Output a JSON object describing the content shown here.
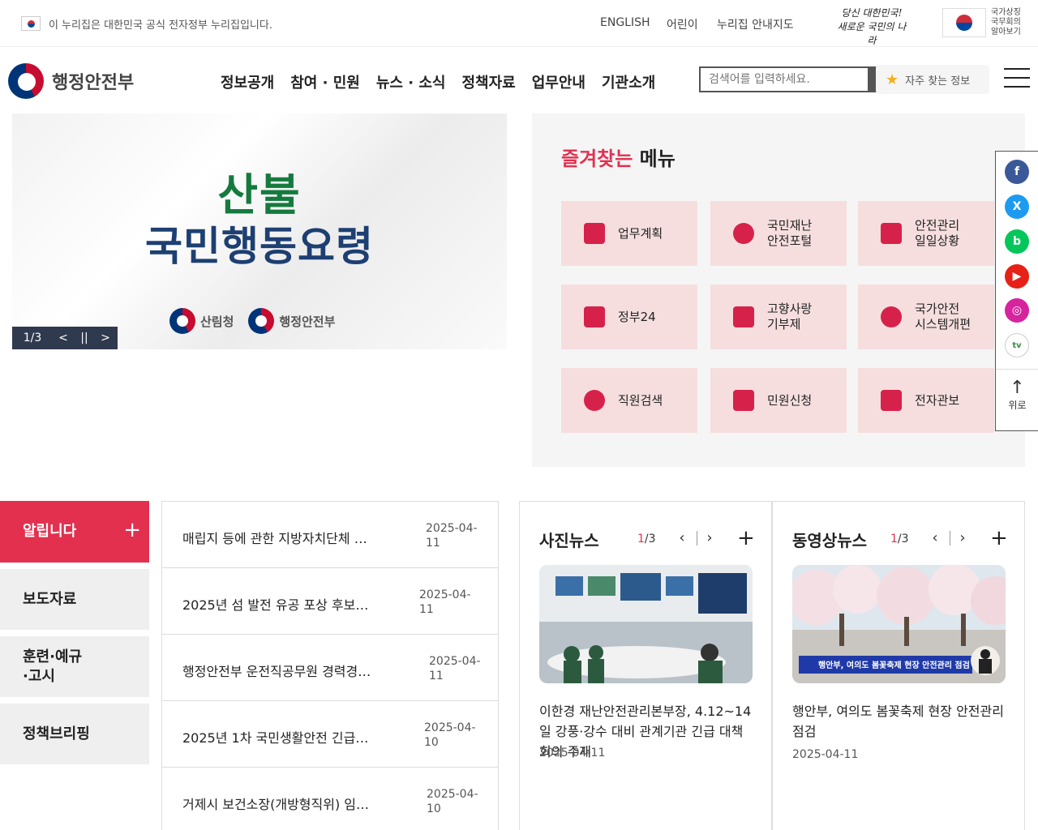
{
  "gov_banner": {
    "text": "이 누리집은 대한민국 공식 전자정부 누리집입니다.",
    "links": [
      "ENGLISH",
      "어린이",
      "누리집 안내지도"
    ],
    "slogan_line1": "당신 대한민국!",
    "slogan_line2": "새로운 국민의 나라",
    "council_lines": [
      "국가상징",
      "국무회의",
      "알아보기"
    ]
  },
  "header": {
    "logo_text": "행정안전부",
    "nav": [
      "정보공개",
      "참여 · 민원",
      "뉴스 · 소식",
      "정책자료",
      "업무안내",
      "기관소개"
    ],
    "search_placeholder": "검색어를 입력하세요.",
    "fav_label": "자주 찾는 정보"
  },
  "hero": {
    "title_line1": "산불",
    "title_line2": "국민행동요령",
    "org1": "산림청",
    "org2": "행정안전부",
    "counter": "1/3",
    "prev": "<",
    "pause": "||",
    "next": ">"
  },
  "favorites": {
    "title_pink": "즐겨찾는",
    "title_rest": " 메뉴",
    "tiles": [
      {
        "line1": "업무계획",
        "line2": ""
      },
      {
        "line1": "국민재난",
        "line2": "안전포털"
      },
      {
        "line1": "안전관리",
        "line2": "일일상황"
      },
      {
        "line1": "정부24",
        "line2": ""
      },
      {
        "line1": "고향사랑",
        "line2": "기부제"
      },
      {
        "line1": "국가안전",
        "line2": "시스템개편"
      },
      {
        "line1": "직원검색",
        "line2": ""
      },
      {
        "line1": "민원신청",
        "line2": ""
      },
      {
        "line1": "전자관보",
        "line2": ""
      }
    ]
  },
  "social": {
    "top_label": "위로",
    "colors": {
      "facebook": "#3b5998",
      "x": "#1d9bf0",
      "blog": "#03c75a",
      "youtube": "#e62117",
      "instagram": "#d6249f",
      "tv": "#3b8c3b"
    }
  },
  "notice": {
    "tabs": [
      {
        "label": "알립니다",
        "plus": "+"
      },
      {
        "label": "보도자료"
      },
      {
        "label_line1": "훈련·예규",
        "label_line2": "·고시"
      },
      {
        "label": "정책브리핑"
      }
    ],
    "items": [
      {
        "title": "매립지 등에 관한 지방자치단체 …",
        "date_line1": "2025-04-",
        "date_line2": "11"
      },
      {
        "title": "2025년 섬 발전 유공 포상 후보…",
        "date_line1": "2025-04-",
        "date_line2": "11"
      },
      {
        "title": "행정안전부 운전직공무원 경력경…",
        "date_line1": "2025-04-",
        "date_line2": "11"
      },
      {
        "title": "2025년 1차 국민생활안전 긴급…",
        "date_line1": "2025-04-",
        "date_line2": "10"
      },
      {
        "title": "거제시 보건소장(개방형직위) 임…",
        "date_line1": "2025-04-",
        "date_line2": "10"
      }
    ]
  },
  "photo_news": {
    "title": "사진뉴스",
    "count_current": "1",
    "count_total": "/3",
    "plus": "+",
    "caption": "이한경 재난안전관리본부장, 4.12~14일 강풍·강수 대비 관계기관 긴급 대책회의 주재",
    "date": "2025-04-11"
  },
  "video_news": {
    "title": "동영상뉴스",
    "count_current": "1",
    "count_total": "/3",
    "plus": "+",
    "image_caption": "행안부, 여의도 봄꽃축제 현장 안전관리 점검",
    "caption": "행안부, 여의도 봄꽃축제 현장 안전관리 점검",
    "date": "2025-04-11"
  },
  "colors": {
    "accent": "#e3304f",
    "tile_bg": "#f6dede",
    "nav_dark": "#2f3a4f"
  }
}
